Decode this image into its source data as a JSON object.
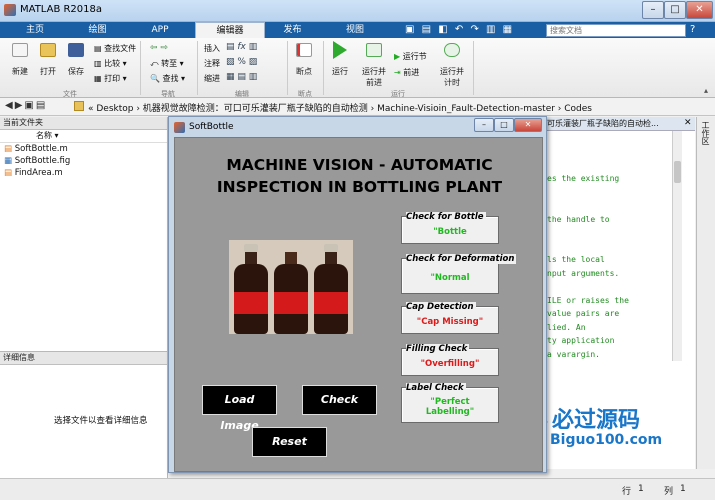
{
  "window": {
    "title": "MATLAB R2018a"
  },
  "tabs": [
    "主页",
    "绘图",
    "APP",
    "编辑器",
    "发布",
    "视图"
  ],
  "search": {
    "placeholder": "搜索文档"
  },
  "ribbon": {
    "file": {
      "new": "新建",
      "open": "打开",
      "save": "保存",
      "find_files": "查找文件",
      "compare": "比较",
      "print": "打印",
      "group": "文件"
    },
    "navigate": {
      "goto": "转至",
      "find": "查找",
      "group": "导航"
    },
    "edit": {
      "insert": "插入",
      "comment": "注释",
      "indent": "缩进",
      "group": "编辑"
    },
    "breakpoints": {
      "label": "断点",
      "group": "断点"
    },
    "run": {
      "run": "运行",
      "run_advance": "运行并\n前进",
      "run_section": "运行节",
      "advance": "前进",
      "run_time": "运行并\n计时",
      "group": "运行"
    }
  },
  "address": {
    "path": "«  Desktop  ›  机器视觉故障检测：可口可乐灌装厂瓶子缺陷的自动检测  ›  Machine-Visioin_Fault-Detection-master  ›  Codes"
  },
  "current_folder": {
    "header": "当前文件夹",
    "col_name": "名称 ▾",
    "files": [
      "SoftBottle.m",
      "SoftBottle.fig",
      "FindArea.m"
    ]
  },
  "details": {
    "header": "详细信息",
    "message": "选择文件以查看详细信息"
  },
  "editor": {
    "header": "可乐灌装厂瓶子缺陷的自动检...",
    "lines": [
      "es the existing",
      "",
      "",
      "the handle to",
      "",
      "",
      "ls the local",
      "nput arguments.",
      "",
      "ILE or raises the",
      "value pairs are",
      "lied.  An",
      "ty application",
      "a varargin."
    ]
  },
  "side_panel": {
    "label": "工作区"
  },
  "status": {
    "row_label": "行",
    "row": "1",
    "col_label": "列",
    "col": "1"
  },
  "figure": {
    "title": "SoftBottle",
    "headline_1": "MACHINE VISION - AUTOMATIC",
    "headline_2": "INSPECTION IN BOTTLING PLANT",
    "groups": [
      {
        "title": "Check for Bottle",
        "value": "\"Bottle",
        "color": "#22b822"
      },
      {
        "title": "Check for Deformation",
        "value": "\"Normal",
        "color": "#22b822"
      },
      {
        "title": "Cap Detection",
        "value": "\"Cap Missing\"",
        "color": "#e01818"
      },
      {
        "title": "Filling Check",
        "value": "\"Overfilling\"",
        "color": "#e01818"
      },
      {
        "title": "Label Check",
        "value": "\"Perfect\nLabelling\"",
        "color": "#22b822"
      }
    ],
    "buttons": {
      "load": "Load Image",
      "check": "Check",
      "reset": "Reset"
    }
  },
  "watermark": {
    "cn": "必过源码",
    "url": "Biguo100.com"
  }
}
